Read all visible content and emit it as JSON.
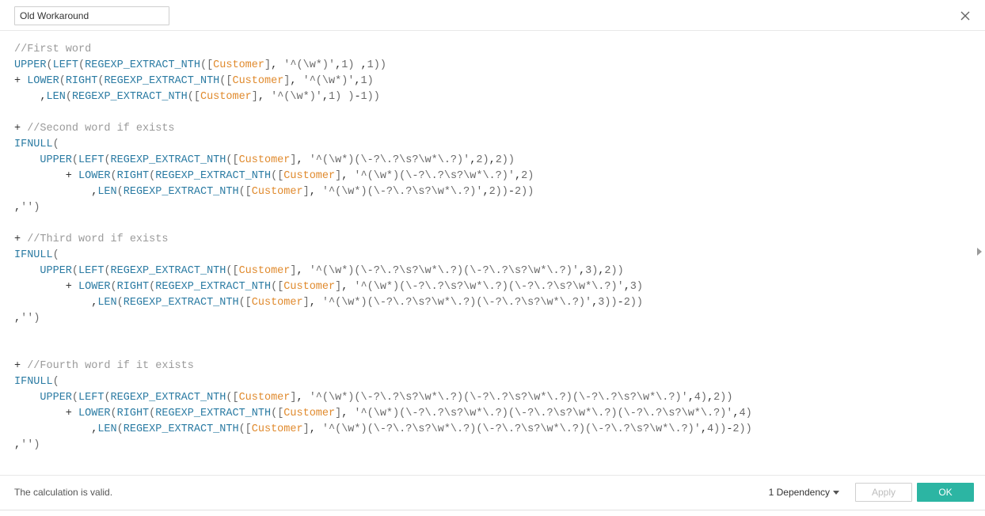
{
  "header": {
    "calc_name": "Old Workaround"
  },
  "code_tokens": [
    [
      [
        "comment",
        "//First word"
      ]
    ],
    [
      [
        "func",
        "UPPER"
      ],
      [
        "brack",
        "("
      ],
      [
        "func",
        "LEFT"
      ],
      [
        "brack",
        "("
      ],
      [
        "func",
        "REGEXP_EXTRACT_NTH"
      ],
      [
        "brack",
        "(["
      ],
      [
        "field",
        "Customer"
      ],
      [
        "brack",
        "]"
      ],
      [
        "op",
        ", "
      ],
      [
        "string",
        "'^(\\w*)'"
      ],
      [
        "op",
        ","
      ],
      [
        "num",
        "1"
      ],
      [
        "brack",
        ") "
      ],
      [
        "op",
        ","
      ],
      [
        "num",
        "1"
      ],
      [
        "brack",
        "))"
      ]
    ],
    [
      [
        "op",
        "+ "
      ],
      [
        "func",
        "LOWER"
      ],
      [
        "brack",
        "("
      ],
      [
        "func",
        "RIGHT"
      ],
      [
        "brack",
        "("
      ],
      [
        "func",
        "REGEXP_EXTRACT_NTH"
      ],
      [
        "brack",
        "(["
      ],
      [
        "field",
        "Customer"
      ],
      [
        "brack",
        "]"
      ],
      [
        "op",
        ", "
      ],
      [
        "string",
        "'^(\\w*)'"
      ],
      [
        "op",
        ","
      ],
      [
        "num",
        "1"
      ],
      [
        "brack",
        ")"
      ]
    ],
    [
      [
        "op",
        "    ,"
      ],
      [
        "func",
        "LEN"
      ],
      [
        "brack",
        "("
      ],
      [
        "func",
        "REGEXP_EXTRACT_NTH"
      ],
      [
        "brack",
        "(["
      ],
      [
        "field",
        "Customer"
      ],
      [
        "brack",
        "]"
      ],
      [
        "op",
        ", "
      ],
      [
        "string",
        "'^(\\w*)'"
      ],
      [
        "op",
        ","
      ],
      [
        "num",
        "1"
      ],
      [
        "brack",
        ") "
      ],
      [
        "brack",
        ")"
      ],
      [
        "op",
        "-"
      ],
      [
        "num",
        "1"
      ],
      [
        "brack",
        "))"
      ]
    ],
    [],
    [
      [
        "op",
        "+ "
      ],
      [
        "comment",
        "//Second word if exists"
      ]
    ],
    [
      [
        "func",
        "IFNULL"
      ],
      [
        "brack",
        "("
      ]
    ],
    [
      [
        "op",
        "    "
      ],
      [
        "func",
        "UPPER"
      ],
      [
        "brack",
        "("
      ],
      [
        "func",
        "LEFT"
      ],
      [
        "brack",
        "("
      ],
      [
        "func",
        "REGEXP_EXTRACT_NTH"
      ],
      [
        "brack",
        "(["
      ],
      [
        "field",
        "Customer"
      ],
      [
        "brack",
        "]"
      ],
      [
        "op",
        ", "
      ],
      [
        "string",
        "'^(\\w*)(\\-?\\.?\\s?\\w*\\.?)'"
      ],
      [
        "op",
        ","
      ],
      [
        "num",
        "2"
      ],
      [
        "brack",
        ")"
      ],
      [
        "op",
        ","
      ],
      [
        "num",
        "2"
      ],
      [
        "brack",
        "))"
      ]
    ],
    [
      [
        "op",
        "        + "
      ],
      [
        "func",
        "LOWER"
      ],
      [
        "brack",
        "("
      ],
      [
        "func",
        "RIGHT"
      ],
      [
        "brack",
        "("
      ],
      [
        "func",
        "REGEXP_EXTRACT_NTH"
      ],
      [
        "brack",
        "(["
      ],
      [
        "field",
        "Customer"
      ],
      [
        "brack",
        "]"
      ],
      [
        "op",
        ", "
      ],
      [
        "string",
        "'^(\\w*)(\\-?\\.?\\s?\\w*\\.?)'"
      ],
      [
        "op",
        ","
      ],
      [
        "num",
        "2"
      ],
      [
        "brack",
        ")"
      ]
    ],
    [
      [
        "op",
        "            ,"
      ],
      [
        "func",
        "LEN"
      ],
      [
        "brack",
        "("
      ],
      [
        "func",
        "REGEXP_EXTRACT_NTH"
      ],
      [
        "brack",
        "(["
      ],
      [
        "field",
        "Customer"
      ],
      [
        "brack",
        "]"
      ],
      [
        "op",
        ", "
      ],
      [
        "string",
        "'^(\\w*)(\\-?\\.?\\s?\\w*\\.?)'"
      ],
      [
        "op",
        ","
      ],
      [
        "num",
        "2"
      ],
      [
        "brack",
        "))"
      ],
      [
        "op",
        "-"
      ],
      [
        "num",
        "2"
      ],
      [
        "brack",
        "))"
      ]
    ],
    [
      [
        "op",
        ","
      ],
      [
        "string",
        "''"
      ],
      [
        "brack",
        ")"
      ]
    ],
    [],
    [
      [
        "op",
        "+ "
      ],
      [
        "comment",
        "//Third word if exists"
      ]
    ],
    [
      [
        "func",
        "IFNULL"
      ],
      [
        "brack",
        "("
      ]
    ],
    [
      [
        "op",
        "    "
      ],
      [
        "func",
        "UPPER"
      ],
      [
        "brack",
        "("
      ],
      [
        "func",
        "LEFT"
      ],
      [
        "brack",
        "("
      ],
      [
        "func",
        "REGEXP_EXTRACT_NTH"
      ],
      [
        "brack",
        "(["
      ],
      [
        "field",
        "Customer"
      ],
      [
        "brack",
        "]"
      ],
      [
        "op",
        ", "
      ],
      [
        "string",
        "'^(\\w*)(\\-?\\.?\\s?\\w*\\.?)(\\-?\\.?\\s?\\w*\\.?)'"
      ],
      [
        "op",
        ","
      ],
      [
        "num",
        "3"
      ],
      [
        "brack",
        ")"
      ],
      [
        "op",
        ","
      ],
      [
        "num",
        "2"
      ],
      [
        "brack",
        "))"
      ]
    ],
    [
      [
        "op",
        "        + "
      ],
      [
        "func",
        "LOWER"
      ],
      [
        "brack",
        "("
      ],
      [
        "func",
        "RIGHT"
      ],
      [
        "brack",
        "("
      ],
      [
        "func",
        "REGEXP_EXTRACT_NTH"
      ],
      [
        "brack",
        "(["
      ],
      [
        "field",
        "Customer"
      ],
      [
        "brack",
        "]"
      ],
      [
        "op",
        ", "
      ],
      [
        "string",
        "'^(\\w*)(\\-?\\.?\\s?\\w*\\.?)(\\-?\\.?\\s?\\w*\\.?)'"
      ],
      [
        "op",
        ","
      ],
      [
        "num",
        "3"
      ],
      [
        "brack",
        ")"
      ]
    ],
    [
      [
        "op",
        "            ,"
      ],
      [
        "func",
        "LEN"
      ],
      [
        "brack",
        "("
      ],
      [
        "func",
        "REGEXP_EXTRACT_NTH"
      ],
      [
        "brack",
        "(["
      ],
      [
        "field",
        "Customer"
      ],
      [
        "brack",
        "]"
      ],
      [
        "op",
        ", "
      ],
      [
        "string",
        "'^(\\w*)(\\-?\\.?\\s?\\w*\\.?)(\\-?\\.?\\s?\\w*\\.?)'"
      ],
      [
        "op",
        ","
      ],
      [
        "num",
        "3"
      ],
      [
        "brack",
        "))"
      ],
      [
        "op",
        "-"
      ],
      [
        "num",
        "2"
      ],
      [
        "brack",
        "))"
      ]
    ],
    [
      [
        "op",
        ","
      ],
      [
        "string",
        "''"
      ],
      [
        "brack",
        ")"
      ]
    ],
    [],
    [],
    [
      [
        "op",
        "+ "
      ],
      [
        "comment",
        "//Fourth word if it exists"
      ]
    ],
    [
      [
        "func",
        "IFNULL"
      ],
      [
        "brack",
        "("
      ]
    ],
    [
      [
        "op",
        "    "
      ],
      [
        "func",
        "UPPER"
      ],
      [
        "brack",
        "("
      ],
      [
        "func",
        "LEFT"
      ],
      [
        "brack",
        "("
      ],
      [
        "func",
        "REGEXP_EXTRACT_NTH"
      ],
      [
        "brack",
        "(["
      ],
      [
        "field",
        "Customer"
      ],
      [
        "brack",
        "]"
      ],
      [
        "op",
        ", "
      ],
      [
        "string",
        "'^(\\w*)(\\-?\\.?\\s?\\w*\\.?)(\\-?\\.?\\s?\\w*\\.?)(\\-?\\.?\\s?\\w*\\.?)'"
      ],
      [
        "op",
        ","
      ],
      [
        "num",
        "4"
      ],
      [
        "brack",
        ")"
      ],
      [
        "op",
        ","
      ],
      [
        "num",
        "2"
      ],
      [
        "brack",
        "))"
      ]
    ],
    [
      [
        "op",
        "        + "
      ],
      [
        "func",
        "LOWER"
      ],
      [
        "brack",
        "("
      ],
      [
        "func",
        "RIGHT"
      ],
      [
        "brack",
        "("
      ],
      [
        "func",
        "REGEXP_EXTRACT_NTH"
      ],
      [
        "brack",
        "(["
      ],
      [
        "field",
        "Customer"
      ],
      [
        "brack",
        "]"
      ],
      [
        "op",
        ", "
      ],
      [
        "string",
        "'^(\\w*)(\\-?\\.?\\s?\\w*\\.?)(\\-?\\.?\\s?\\w*\\.?)(\\-?\\.?\\s?\\w*\\.?)'"
      ],
      [
        "op",
        ","
      ],
      [
        "num",
        "4"
      ],
      [
        "brack",
        ")"
      ]
    ],
    [
      [
        "op",
        "            ,"
      ],
      [
        "func",
        "LEN"
      ],
      [
        "brack",
        "("
      ],
      [
        "func",
        "REGEXP_EXTRACT_NTH"
      ],
      [
        "brack",
        "(["
      ],
      [
        "field",
        "Customer"
      ],
      [
        "brack",
        "]"
      ],
      [
        "op",
        ", "
      ],
      [
        "string",
        "'^(\\w*)(\\-?\\.?\\s?\\w*\\.?)(\\-?\\.?\\s?\\w*\\.?)(\\-?\\.?\\s?\\w*\\.?)'"
      ],
      [
        "op",
        ","
      ],
      [
        "num",
        "4"
      ],
      [
        "brack",
        "))"
      ],
      [
        "op",
        "-"
      ],
      [
        "num",
        "2"
      ],
      [
        "brack",
        "))"
      ]
    ],
    [
      [
        "op",
        ","
      ],
      [
        "string",
        "''"
      ],
      [
        "brack",
        ")"
      ]
    ]
  ],
  "footer": {
    "status": "The calculation is valid.",
    "dependency_label": "1 Dependency",
    "apply_label": "Apply",
    "ok_label": "OK"
  }
}
